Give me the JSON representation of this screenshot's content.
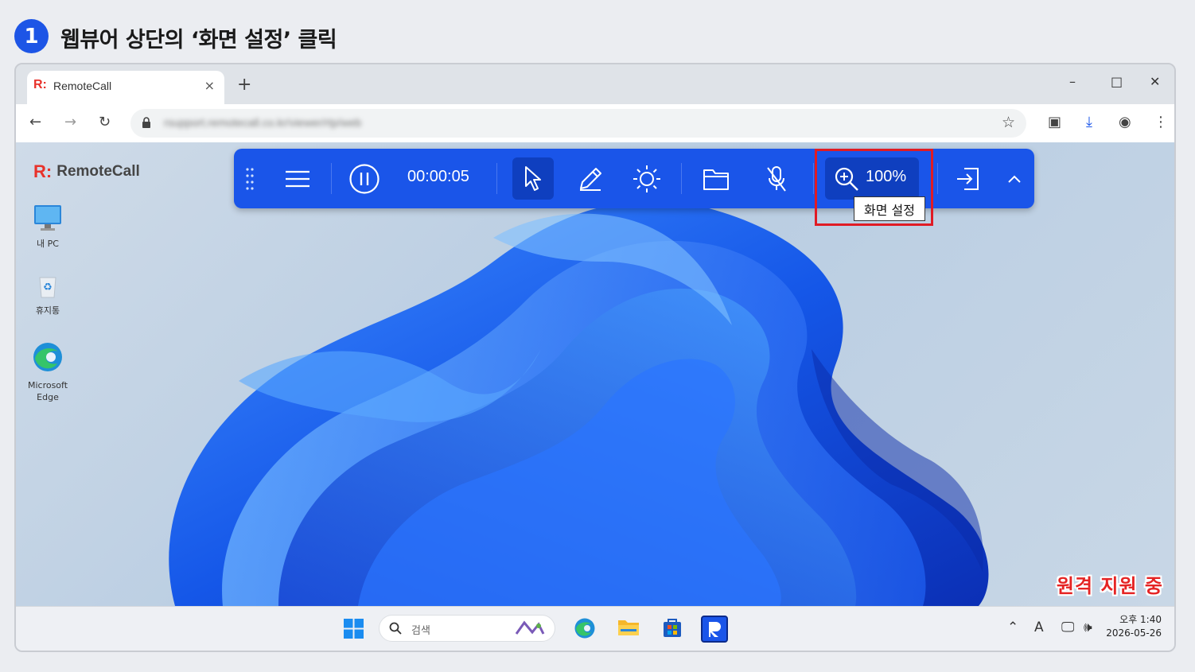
{
  "step": {
    "number": "1",
    "title": "웹뷰어 상단의 ‘화면 설정’ 클릭"
  },
  "browser": {
    "tab_title": "RemoteCall",
    "tab_logo": "R:",
    "tab_close": "×",
    "new_tab": "+",
    "url": "rsupport.remotecall.co.kr/viewer/rtp/web",
    "window_controls": {
      "minimize": "–",
      "maximize": "□",
      "close": "✕"
    }
  },
  "remote": {
    "brand": "RemoteCall",
    "brand_mark": "R:",
    "desktop_icons": [
      {
        "label": "내 PC",
        "icon": "monitor-icon"
      },
      {
        "label": "휴지통",
        "icon": "recycle-bin-icon"
      },
      {
        "label_line1": "Microsoft",
        "label_line2": "Edge",
        "icon": "edge-icon"
      }
    ],
    "toolbar": {
      "timer": "00:00:05",
      "zoom_value": "100%",
      "tooltip": "화면 설정",
      "accent_color": "#1a55e9"
    },
    "status_text": "원격 지원 중",
    "taskbar": {
      "search_placeholder": "검색",
      "clock_ampm_time": "오후 1:40",
      "clock_date": "2026-05-26",
      "ime": "A"
    }
  },
  "highlight_color": "#e01b24"
}
